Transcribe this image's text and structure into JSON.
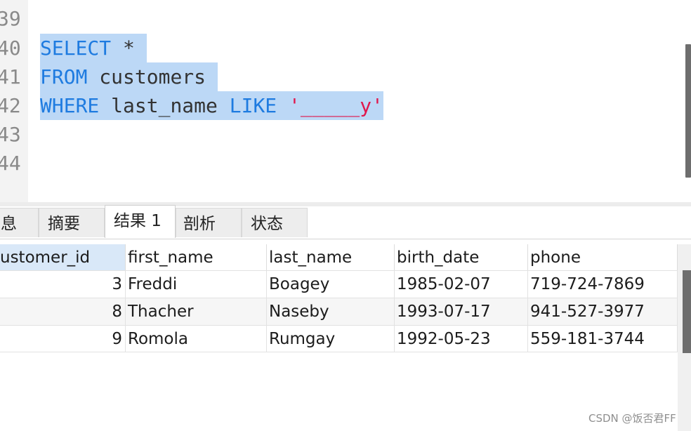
{
  "editor": {
    "line_numbers": [
      "39",
      "40",
      "41",
      "42",
      "43",
      "44"
    ],
    "lines": {
      "l40_kw": "SELECT",
      "l40_rest": " * ",
      "l41_kw": "FROM",
      "l41_rest": " customers ",
      "l42_kw1": "WHERE",
      "l42_mid": " last_name ",
      "l42_kw2": "LIKE",
      "l42_sp": " ",
      "l42_q1": "'",
      "l42_blank": "_____",
      "l42_tail": "y'"
    }
  },
  "tabs": [
    {
      "label": "息"
    },
    {
      "label": "摘要"
    },
    {
      "label": "结果 1"
    },
    {
      "label": "剖析"
    },
    {
      "label": "状态"
    }
  ],
  "grid": {
    "columns": [
      "ustomer_id",
      "first_name",
      "last_name",
      "birth_date",
      "phone"
    ],
    "rows": [
      {
        "customer_id": "3",
        "first_name": "Freddi",
        "last_name": "Boagey",
        "birth_date": "1985-02-07",
        "phone": "719-724-7869"
      },
      {
        "customer_id": "8",
        "first_name": "Thacher",
        "last_name": "Naseby",
        "birth_date": "1993-07-17",
        "phone": "941-527-3977"
      },
      {
        "customer_id": "9",
        "first_name": "Romola",
        "last_name": "Rumgay",
        "birth_date": "1992-05-23",
        "phone": "559-181-3744"
      }
    ]
  },
  "watermark": "CSDN @饭否君FF",
  "colors": {
    "keyword": "#1e7be0",
    "string": "#e0174c",
    "selection": "#bcd8f6",
    "header_highlight": "#d9e8f8"
  }
}
